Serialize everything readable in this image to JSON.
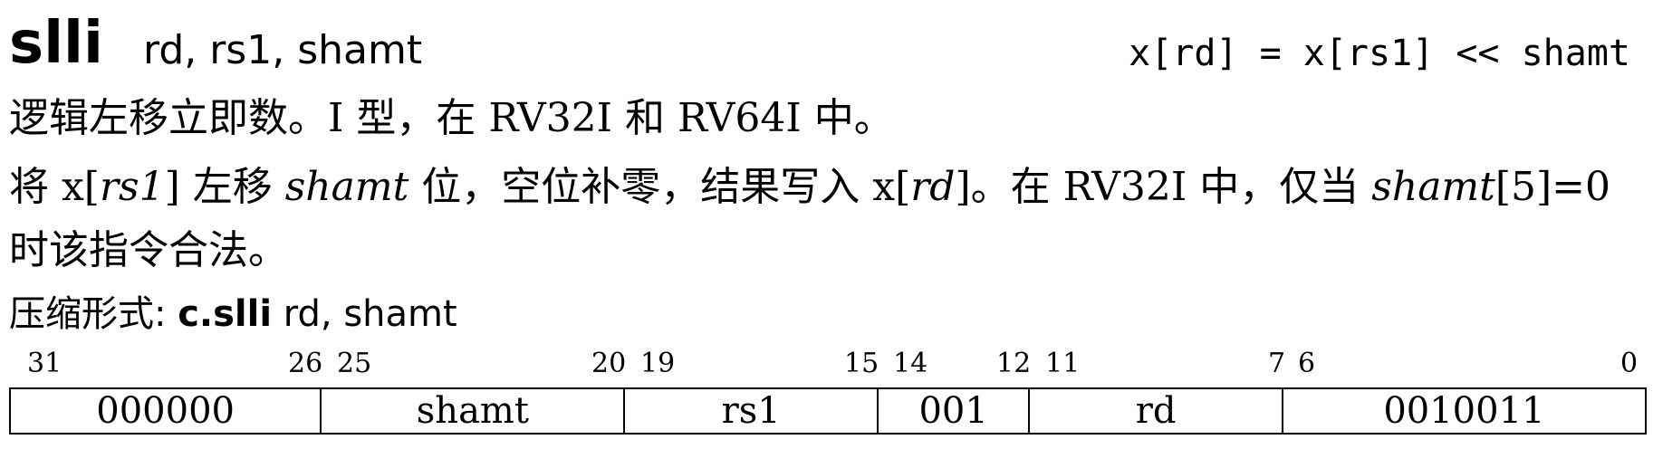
{
  "header": {
    "mnemonic": "slli",
    "operands": "rd, rs1, shamt",
    "formula": "x[rd] = x[rs1] << shamt"
  },
  "description": {
    "line1": "逻辑左移立即数。I 型，在 RV32I 和 RV64I 中。",
    "line2_a": "将 x[",
    "line2_rs1": "rs1",
    "line2_b": "] 左移 ",
    "line2_shamt": "shamt",
    "line2_c": " 位，空位补零，结果写入 x[",
    "line2_rd": "rd",
    "line2_d": "]。在 RV32I 中，仅当 ",
    "line2_shamt2": "shamt",
    "line2_e": "[5]=0",
    "line3": "时该指令合法。",
    "compressed_label": "压缩形式: ",
    "compressed_name": "c.slli",
    "compressed_operands": " rd, shamt"
  },
  "encoding": {
    "bit_labels": [
      "31",
      "26",
      "25",
      "20",
      "19",
      "15",
      "14",
      "12",
      "11",
      "7",
      "6",
      "0"
    ],
    "fields": [
      "000000",
      "shamt",
      "rs1",
      "001",
      "rd",
      "0010011"
    ]
  }
}
